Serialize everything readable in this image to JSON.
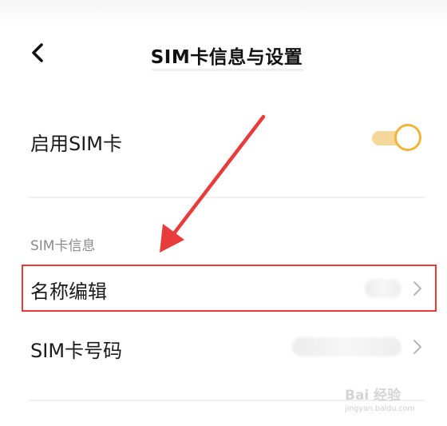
{
  "header": {
    "title": "SIM卡信息与设置",
    "back_icon": "back-arrow-icon"
  },
  "enable_sim": {
    "label": "启用SIM卡",
    "toggle_state": "on",
    "toggle_color": "#f0b43a"
  },
  "sim_info": {
    "section_title": "SIM卡信息",
    "rows": [
      {
        "label": "名称编辑",
        "value_blurred": true,
        "chevron_icon": "chevron-right-icon"
      },
      {
        "label": "SIM卡号码",
        "value_blurred": true,
        "chevron_icon": "chevron-right-icon"
      }
    ]
  },
  "annotation": {
    "arrow_color": "#e83b3b",
    "highlight_color": "#e83b3b"
  },
  "watermark": {
    "main": "Bai 经验",
    "sub": "jingyan.baidu.com"
  }
}
